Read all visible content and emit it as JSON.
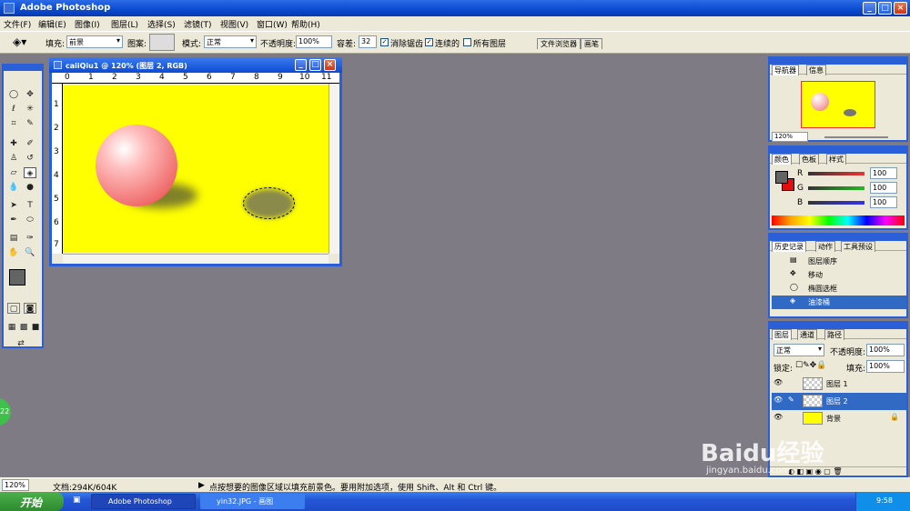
{
  "app": {
    "title": "Adobe Photoshop"
  },
  "menu": [
    "文件(F)",
    "编辑(E)",
    "图像(I)",
    "图层(L)",
    "选择(S)",
    "滤镜(T)",
    "视图(V)",
    "窗口(W)",
    "帮助(H)"
  ],
  "options": {
    "fill_label": "填充:",
    "fill_value": "前景",
    "pattern_label": "图案:",
    "mode_label": "模式:",
    "mode_value": "正常",
    "opacity_label": "不透明度:",
    "opacity_value": "100%",
    "tolerance_label": "容差:",
    "tolerance_value": "32",
    "antialias": "消除锯齿",
    "contiguous": "连续的",
    "all_layers": "所有图层",
    "tab1": "文件浏览器",
    "tab2": "画笔"
  },
  "document": {
    "title": "caiiQiu1 @ 120% (图层 2, RGB)",
    "ruler": [
      "0",
      "1",
      "2",
      "3",
      "4",
      "5",
      "6",
      "7",
      "8",
      "9",
      "10",
      "11"
    ],
    "ruler_v": [
      "1",
      "2",
      "3",
      "4",
      "5",
      "6",
      "7"
    ]
  },
  "navigator": {
    "tabs": [
      "导航器",
      "信息"
    ],
    "zoom": "120%"
  },
  "color": {
    "tabs": [
      "颜色",
      "色板",
      "样式"
    ],
    "r_label": "R",
    "g_label": "G",
    "b_label": "B",
    "r": "100",
    "g": "100",
    "b": "100"
  },
  "history": {
    "tabs": [
      "历史记录",
      "动作",
      "工具预设"
    ],
    "items": [
      "图层顺序",
      "移动",
      "椭圆选框",
      "油漆桶"
    ]
  },
  "layers": {
    "tabs": [
      "图层",
      "通道",
      "路径"
    ],
    "blend": "正常",
    "opacity_label": "不透明度:",
    "opacity": "100%",
    "lock_label": "锁定:",
    "fill_label": "填充:",
    "fill": "100%",
    "items": [
      "图层 1",
      "图层 2",
      "背景"
    ]
  },
  "status": {
    "zoom": "120%",
    "doc": "文档:294K/604K",
    "hint": "点按想要的图像区域以填充前景色。要用附加选项，使用 Shift、Alt 和 Ctrl 键。"
  },
  "taskbar": {
    "start": "开始",
    "tasks": [
      "Adobe Photoshop",
      "yin32.JPG - 画图"
    ],
    "time": "9:58"
  },
  "watermark": {
    "logo": "Baidu经验",
    "url": "jingyan.baidu.com"
  },
  "badge": "22"
}
